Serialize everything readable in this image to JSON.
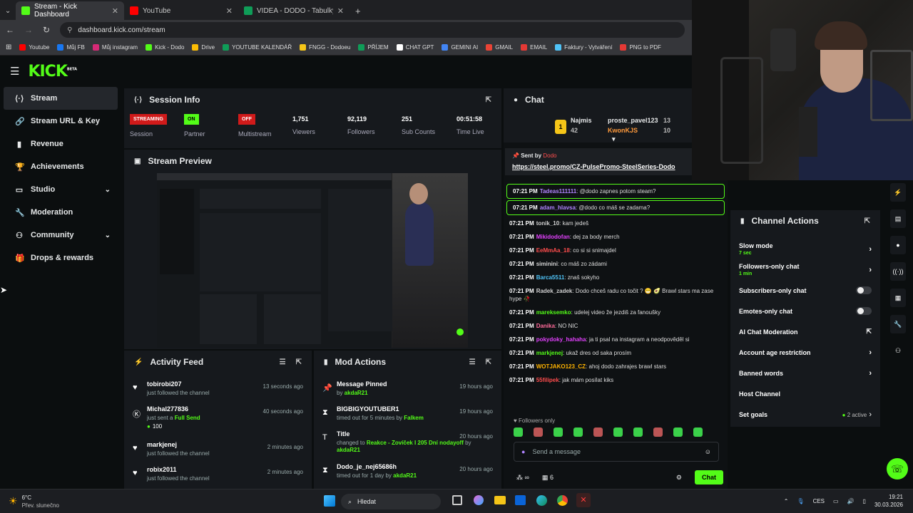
{
  "browser": {
    "tabs": [
      {
        "label": "Stream - Kick Dashboard",
        "active": true,
        "icon": "kick-favicon",
        "color": "#53fc18"
      },
      {
        "label": "YouTube",
        "active": false,
        "icon": "youtube-favicon",
        "color": "#ff0000"
      },
      {
        "label": "VIDEA - DODO - Tabulky Googl...",
        "active": false,
        "icon": "sheets-favicon",
        "color": "#0f9d58"
      }
    ],
    "url": "dashboard.kick.com/stream",
    "bookmarks": [
      {
        "label": "Youtube",
        "color": "#ff0000"
      },
      {
        "label": "Můj FB",
        "color": "#1877f2"
      },
      {
        "label": "Můj instagram",
        "color": "#d62976"
      },
      {
        "label": "Kick - Dodo",
        "color": "#53fc18"
      },
      {
        "label": "Drive",
        "color": "#fbbc04"
      },
      {
        "label": "YOUTUBE KALENDÁŘ",
        "color": "#0f9d58"
      },
      {
        "label": "FNGG - Dodoeu",
        "color": "#f5c518"
      },
      {
        "label": "PŘÍJEM",
        "color": "#0f9d58"
      },
      {
        "label": "CHAT GPT",
        "color": "#ffffff"
      },
      {
        "label": "GEMINI AI",
        "color": "#4285f4"
      },
      {
        "label": "GMAIL",
        "color": "#ea4335"
      },
      {
        "label": "EMAIL",
        "color": "#e53935"
      },
      {
        "label": "Faktury - Vytváření",
        "color": "#4fc3f7"
      },
      {
        "label": "PNG to PDF",
        "color": "#e53935"
      }
    ]
  },
  "sidebar": {
    "logo": "KICK",
    "logo_sup": "BETA",
    "items": [
      {
        "label": "Stream",
        "icon": "stream-icon",
        "active": true,
        "chevron": false
      },
      {
        "label": "Stream URL & Key",
        "icon": "link-icon",
        "active": false,
        "chevron": false
      },
      {
        "label": "Revenue",
        "icon": "revenue-icon",
        "active": false,
        "chevron": false
      },
      {
        "label": "Achievements",
        "icon": "trophy-icon",
        "active": false,
        "chevron": false
      },
      {
        "label": "Studio",
        "icon": "studio-icon",
        "active": false,
        "chevron": true
      },
      {
        "label": "Moderation",
        "icon": "wrench-icon",
        "active": false,
        "chevron": false
      },
      {
        "label": "Community",
        "icon": "community-icon",
        "active": false,
        "chevron": true
      },
      {
        "label": "Drops & rewards",
        "icon": "gift-icon",
        "active": false,
        "chevron": false
      }
    ]
  },
  "session": {
    "title": "Session Info",
    "streaming_badge": "STREAMING",
    "session_label": "Session",
    "partner_badge": "ON",
    "partner_label": "Partner",
    "multistream_badge": "OFF",
    "multistream_label": "Multistream",
    "stats": [
      {
        "value": "1,751",
        "label": "Viewers"
      },
      {
        "value": "92,119",
        "label": "Followers"
      },
      {
        "value": "251",
        "label": "Sub Counts"
      },
      {
        "value": "00:51:58",
        "label": "Time Live"
      }
    ]
  },
  "preview": {
    "title": "Stream Preview"
  },
  "activity": {
    "title": "Activity Feed",
    "items": [
      {
        "name": "tobirobi207",
        "sub": "just followed the channel",
        "extra": "",
        "time": "13 seconds ago",
        "icon": "heart-icon"
      },
      {
        "name": "Michal277836",
        "sub": "just sent a ",
        "sub_hl": "Full Send",
        "extra": "100",
        "time": "40 seconds ago",
        "icon": "kick-coin-icon"
      },
      {
        "name": "markjenej",
        "sub": "just followed the channel",
        "extra": "",
        "time": "2 minutes ago",
        "icon": "heart-icon"
      },
      {
        "name": "robix2011",
        "sub": "just followed the channel",
        "extra": "",
        "time": "2 minutes ago",
        "icon": "heart-icon"
      }
    ]
  },
  "mod": {
    "title": "Mod Actions",
    "items": [
      {
        "name": "Message Pinned",
        "pre": "by ",
        "who": "akdaR21",
        "mid": "",
        "who2": "",
        "time": "19 hours ago",
        "icon": "pin-icon"
      },
      {
        "name": "BIGBIGYOUTUBER1",
        "pre": "timed out for 5 minutes by ",
        "who": "Falkem",
        "mid": "",
        "who2": "",
        "time": "19 hours ago",
        "icon": "hourglass-icon"
      },
      {
        "name": "Title",
        "pre": "changed to ",
        "who": "Reakce - Zovíček I 205 Dní nodayoff",
        "mid": " by ",
        "who2": "akdaR21",
        "time": "20 hours ago",
        "icon": "title-icon"
      },
      {
        "name": "Dodo_je_nej65686h",
        "pre": "timed out for 1 day by ",
        "who": "akdaR21",
        "mid": "",
        "who2": "",
        "time": "20 hours ago",
        "icon": "hourglass-icon"
      }
    ]
  },
  "chat": {
    "title": "Chat",
    "leaders": {
      "first_name": "Najmis",
      "first_count": "42",
      "second_name": "proste_pavel123",
      "second_count": "13",
      "third_name": "KwonKJS",
      "third_count": "10",
      "rank": "1"
    },
    "pinned_sent_by": "Sent by",
    "pinned_user": "Dodo",
    "pinned_link": "https://steel.promo/CZ-PulsePromo-SteelSeries-Dodo",
    "messages": [
      {
        "time": "07:21 PM",
        "user": "Tadeas111111",
        "color": "#b084ff",
        "text": "@dodo zapnes potom steam?",
        "hl": true
      },
      {
        "time": "07:21 PM",
        "user": "adam_hlavsa",
        "color": "#b084ff",
        "text": "@dodo co máš se zadama?",
        "hl": true
      },
      {
        "time": "07:21 PM",
        "user": "tonik_10",
        "color": "#d0d0d0",
        "text": "kam jedeš",
        "hl": false
      },
      {
        "time": "07:21 PM",
        "user": "Mikidodofan",
        "color": "#e040fb",
        "text": "dej za body merch",
        "hl": false
      },
      {
        "time": "07:21 PM",
        "user": "EeMmAa_18",
        "color": "#ff4d4d",
        "text": "co si si snimajdel",
        "hl": false
      },
      {
        "time": "07:21 PM",
        "user": "siminini",
        "color": "#d0d0d0",
        "text": "co máš zo zádami",
        "hl": false
      },
      {
        "time": "07:21 PM",
        "user": "Barca5511",
        "color": "#4fc3f7",
        "text": "znaš sokyho",
        "hl": false
      },
      {
        "time": "07:21 PM",
        "user": "Radek_zadek",
        "color": "#d0d0d0",
        "text": "Dodo chceš radu co točit ? 😁 🥑 Brawl stars ma zase hype 🥀",
        "hl": false
      },
      {
        "time": "07:21 PM",
        "user": "mareksemko",
        "color": "#53fc18",
        "text": "udelej video že jezdiš za fanoušky",
        "hl": false
      },
      {
        "time": "07:21 PM",
        "user": "Danika",
        "color": "#ff6b9a",
        "text": "NO NIC",
        "hl": false
      },
      {
        "time": "07:21 PM",
        "user": "pokydoky_hahaha",
        "color": "#e040fb",
        "text": "ja ti psal na instagram a neodpověděl si",
        "hl": false
      },
      {
        "time": "07:21 PM",
        "user": "markjenej",
        "color": "#53fc18",
        "text": "ukaž dres od saka prosím",
        "hl": false
      },
      {
        "time": "07:21 PM",
        "user": "WOTJAKO123_CZ",
        "color": "#ffb300",
        "text": "ahoj dodo zahrajes brawl stars",
        "hl": false
      },
      {
        "time": "07:21 PM",
        "user": "55filipek",
        "color": "#ff4d4d",
        "text": "jak mám posílat kiks",
        "hl": false
      }
    ],
    "followers_only": "Followers only",
    "input_placeholder": "Send a message",
    "count": "6",
    "send_label": "Chat"
  },
  "channel_actions": {
    "title": "Channel Actions",
    "items": [
      {
        "label": "Slow mode",
        "sub": "7 sec",
        "control": "chevron"
      },
      {
        "label": "Followers-only chat",
        "sub": "1 min",
        "control": "chevron"
      },
      {
        "label": "Subscribers-only chat",
        "sub": "",
        "control": "toggle"
      },
      {
        "label": "Emotes-only chat",
        "sub": "",
        "control": "toggle"
      },
      {
        "label": "AI Chat Moderation",
        "sub": "",
        "control": "external"
      },
      {
        "label": "Account age restriction",
        "sub": "",
        "control": "chevron"
      },
      {
        "label": "Banned words",
        "sub": "",
        "control": "chevron"
      },
      {
        "label": "Host Channel",
        "sub": "",
        "control": "none"
      },
      {
        "label": "Set goals",
        "sub": "",
        "control": "goals",
        "goals_text": "2 active"
      }
    ]
  },
  "taskbar": {
    "weather_temp": "6°C",
    "weather_desc": "Přev. slunečno",
    "search_placeholder": "Hledat",
    "lang": "CES",
    "time": "19:21",
    "date": "30.03.2026"
  }
}
